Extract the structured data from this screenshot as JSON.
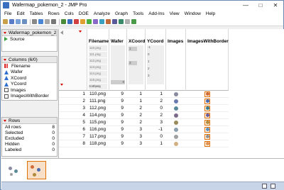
{
  "window": {
    "title": "Wafermap_pokemon_2 - JMP Pro"
  },
  "menu": [
    "File",
    "Edit",
    "Tables",
    "Rows",
    "Cols",
    "DOE",
    "Analyze",
    "Graph",
    "Tools",
    "Add-Ins",
    "View",
    "Window",
    "Help"
  ],
  "table_panel": {
    "name": "Wafermap_pokemon_2",
    "source_label": "Source"
  },
  "columns_panel": {
    "header": "Columns (6/0)",
    "items": [
      "Filename",
      "Wafer",
      "XCoord",
      "YCoord",
      "Images",
      "ImagesWithBorder"
    ]
  },
  "rows_panel": {
    "header": "Rows",
    "items": [
      {
        "label": "All rows",
        "value": "8"
      },
      {
        "label": "Selected",
        "value": "0"
      },
      {
        "label": "Excluded",
        "value": "0"
      },
      {
        "label": "Hidden",
        "value": "0"
      },
      {
        "label": "Labeled",
        "value": "0"
      }
    ]
  },
  "grid": {
    "headers": [
      "Filename",
      "Wafer",
      "XCoord",
      "YCoord",
      "Images",
      "ImagesWithBorder"
    ],
    "filename_summary": [
      "110.png",
      "111.png",
      "112.png",
      "113.png",
      "114.png",
      "115.png",
      "116.png",
      "3 others"
    ],
    "wafer_summary": [
      "8"
    ],
    "xcoord_summary": [
      "1",
      "3"
    ],
    "ycoord_summary": [
      "-1",
      "0",
      "1",
      "2",
      "3"
    ],
    "rows": [
      {
        "n": "1",
        "filename": "110.png",
        "wafer": "9",
        "x": "1",
        "y": "1"
      },
      {
        "n": "2",
        "filename": "111.png",
        "wafer": "9",
        "x": "1",
        "y": "2"
      },
      {
        "n": "3",
        "filename": "112.png",
        "wafer": "9",
        "x": "2",
        "y": "0"
      },
      {
        "n": "4",
        "filename": "114.png",
        "wafer": "9",
        "x": "2",
        "y": "2"
      },
      {
        "n": "5",
        "filename": "115.png",
        "wafer": "9",
        "x": "2",
        "y": "3"
      },
      {
        "n": "6",
        "filename": "116.png",
        "wafer": "9",
        "x": "3",
        "y": "-1"
      },
      {
        "n": "7",
        "filename": "117.png",
        "wafer": "9",
        "x": "3",
        "y": "0"
      },
      {
        "n": "8",
        "filename": "118.png",
        "wafer": "9",
        "x": "3",
        "y": "1"
      }
    ]
  },
  "colors": {
    "red_triangle": "#dd0000",
    "border_orange": "#e07000",
    "status_bar": "#c8d4e8"
  },
  "icons": {
    "nominal_column": "red-bars-icon",
    "continuous_column": "blue-triangle-icon",
    "image_column": "image-icon",
    "script": "green-play-icon"
  }
}
